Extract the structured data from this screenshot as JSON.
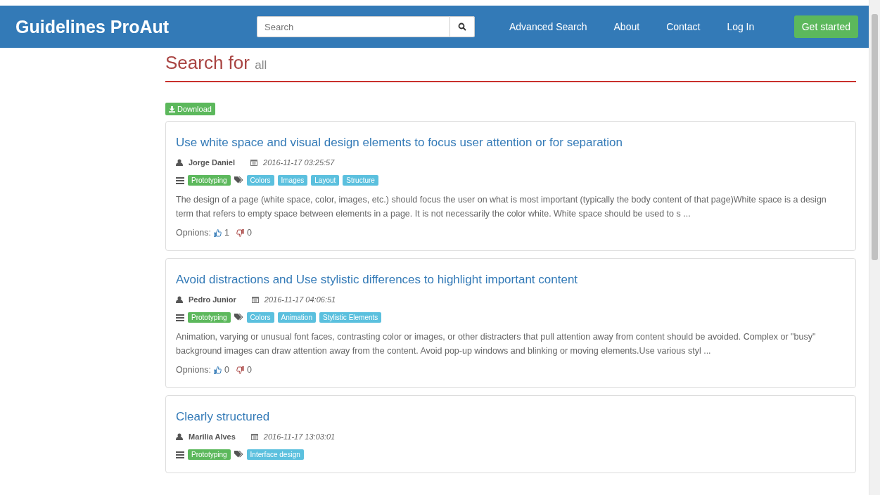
{
  "navbar": {
    "brand": "Guidelines ProAut",
    "search": {
      "placeholder": "Search"
    },
    "links": [
      "Advanced Search",
      "About",
      "Contact",
      "Log In"
    ],
    "cta": "Get started"
  },
  "heading": {
    "title": "Search for",
    "query": "all"
  },
  "download": "Download",
  "results": [
    {
      "title": "Use white space and visual design elements to focus user attention or for separation",
      "author": "Jorge Daniel",
      "date": "2016-11-17 03:25:57",
      "category": "Prototyping",
      "tags": [
        "Colors",
        "Images",
        "Layout",
        "Structure"
      ],
      "body": "The design of a page (white space, color, images, etc.) should focus the user on what is most important (typically the body content of that page)White space is a design term that refers to empty space between elements in a page. It is not necessarily the color white. White space should be used to s ...",
      "opinions_label": "Opnions:",
      "likes": "1",
      "dislikes": "0"
    },
    {
      "title": "Avoid distractions and Use stylistic differences to highlight important content",
      "author": "Pedro Junior",
      "date": "2016-11-17 04:06:51",
      "category": "Prototyping",
      "tags": [
        "Colors",
        "Animation",
        "Stylistic Elements"
      ],
      "body": "Animation, varying or unusual font faces, contrasting color or images, or other distracters that pull attention away from content should be avoided. Complex or \"busy\" background images can draw attention away from the content. Avoid pop-up windows and blinking or moving elements.Use various styl ...",
      "opinions_label": "Opnions:",
      "likes": "0",
      "dislikes": "0"
    },
    {
      "title": "Clearly structured",
      "author": "Marilia Alves",
      "date": "2016-11-17 13:03:01",
      "category": "Prototyping",
      "tags": [
        "Interface design"
      ]
    }
  ]
}
